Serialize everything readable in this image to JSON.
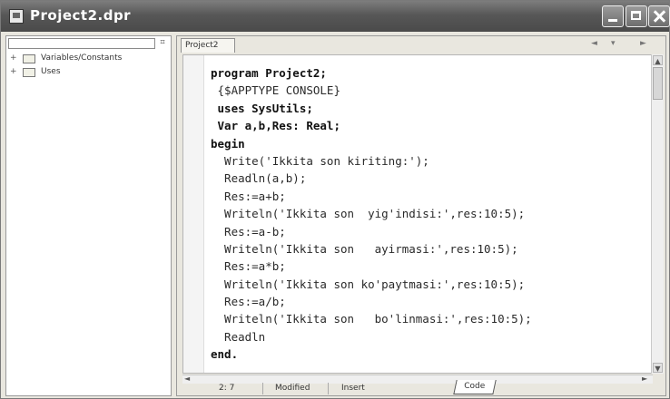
{
  "window": {
    "title": "Project2.dpr"
  },
  "tree": {
    "items": [
      {
        "label": "Variables/Constants"
      },
      {
        "label": "Uses"
      }
    ]
  },
  "editor": {
    "tab_label": "Project2",
    "code_lines": [
      "program Project2;",
      " {$APPTYPE CONSOLE}",
      " uses SysUtils;",
      " Var a,b,Res: Real;",
      "begin",
      "  Write('Ikkita son kiriting:');",
      "  Readln(a,b);",
      "  Res:=a+b;",
      "  Writeln('Ikkita son  yig'indisi:',res:10:5);",
      "  Res:=a-b;",
      "  Writeln('Ikkita son   ayirmasi:',res:10:5);",
      "  Res:=a*b;",
      "  Writeln('Ikkita son ko'paytmasi:',res:10:5);",
      "  Res:=a/b;",
      "  Writeln('Ikkita son   bo'linmasi:',res:10:5);",
      "  Readln",
      "end."
    ]
  },
  "status": {
    "position": "2: 7",
    "modified": "Modified",
    "insert": "Insert",
    "view_tab": "Code"
  }
}
